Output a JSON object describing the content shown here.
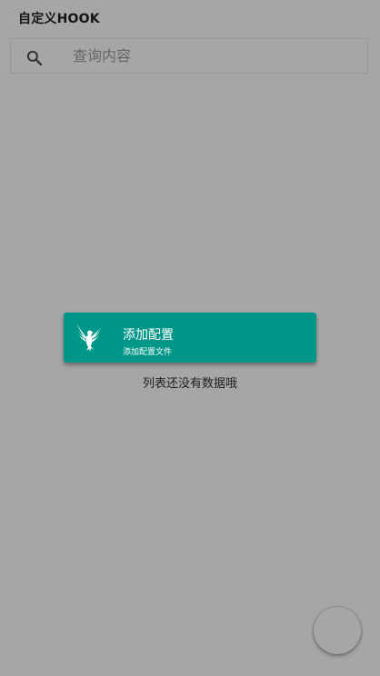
{
  "app_bar": {
    "title": "自定义HOOK"
  },
  "search": {
    "placeholder": "查询内容",
    "value": "",
    "icon": "search-icon"
  },
  "add_config_card": {
    "icon": "eagle-icon",
    "title": "添加配置",
    "subtitle": "添加配置文件",
    "background_color": "#009688"
  },
  "empty_state": {
    "message": "列表还没有数据哦"
  },
  "overlay_color": "#a6a6a6"
}
